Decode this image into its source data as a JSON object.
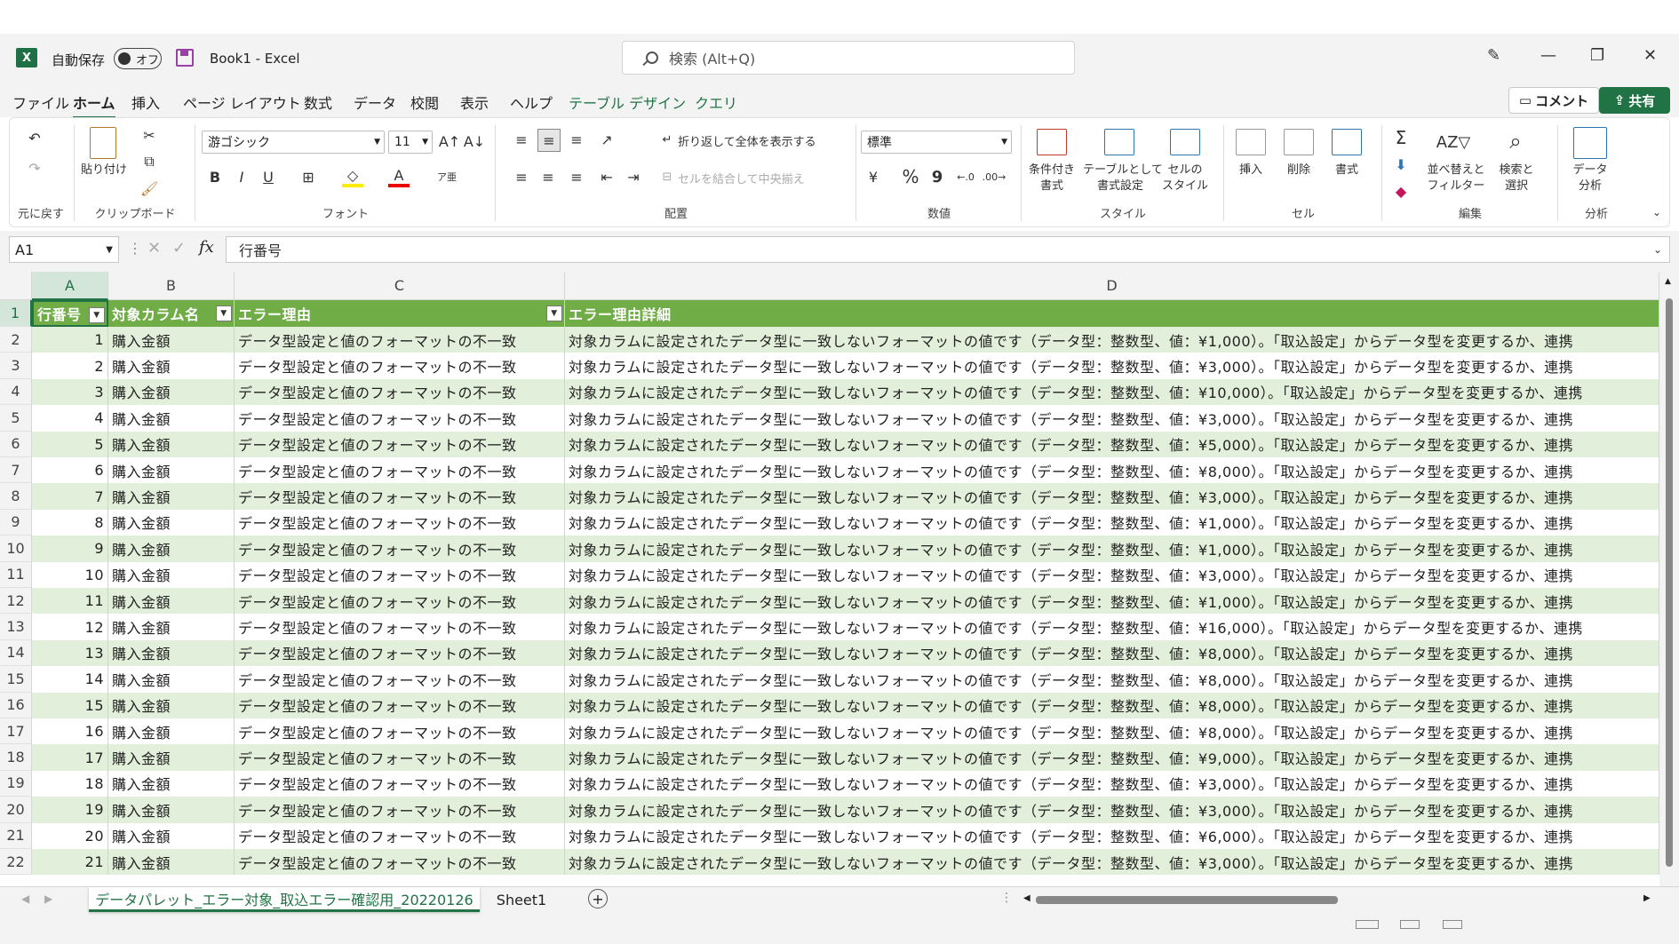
{
  "title_bar": {
    "autosave_label": "自動保存",
    "toggle_label": "オフ",
    "document_title": "Book1  -  Excel",
    "search_placeholder": "検索 (Alt+Q)"
  },
  "ribbon_tabs": [
    "ファイル",
    "ホーム",
    "挿入",
    "ページ レイアウト",
    "数式",
    "データ",
    "校閲",
    "表示",
    "ヘルプ",
    "テーブル デザイン",
    "クエリ"
  ],
  "active_tab": "ホーム",
  "actions": {
    "comment": "コメント",
    "share": "共有"
  },
  "ribbon": {
    "undo_group": "元に戻す",
    "clipboard": {
      "paste": "貼り付け",
      "group": "クリップボード"
    },
    "font": {
      "name": "游ゴシック",
      "size": "11",
      "bold": "B",
      "italic": "I",
      "underline": "U",
      "group": "フォント"
    },
    "alignment": {
      "wrap": "折り返して全体を表示する",
      "merge": "セルを結合して中央揃え",
      "group": "配置"
    },
    "number": {
      "format": "標準",
      "percent": "%",
      "comma": "9",
      "group": "数値"
    },
    "styles": {
      "conditional": "条件付き\n書式",
      "table": "テーブルとして\n書式設定",
      "cell": "セルの\nスタイル",
      "group": "スタイル"
    },
    "cells": {
      "insert": "挿入",
      "delete": "削除",
      "format": "書式",
      "group": "セル"
    },
    "editing": {
      "sort": "並べ替えと\nフィルター",
      "find": "検索と\n選択",
      "group": "編集"
    },
    "analysis": {
      "analyze": "データ\n分析",
      "group": "分析"
    }
  },
  "formula_bar": {
    "name_box": "A1",
    "fx": "fx",
    "content": "行番号"
  },
  "columns": [
    "A",
    "B",
    "C",
    "D"
  ],
  "table_headers": [
    "行番号",
    "対象カラム名",
    "エラー理由",
    "エラー理由詳細"
  ],
  "rows": [
    {
      "n": "1",
      "col": "購入金額",
      "reason": "データ型設定と値のフォーマットの不一致",
      "detail": "対象カラムに設定されたデータ型に一致しないフォーマットの値です（データ型：整数型、値：¥1,000）。「取込設定」からデータ型を変更するか、連携"
    },
    {
      "n": "2",
      "col": "購入金額",
      "reason": "データ型設定と値のフォーマットの不一致",
      "detail": "対象カラムに設定されたデータ型に一致しないフォーマットの値です（データ型：整数型、値：¥3,000）。「取込設定」からデータ型を変更するか、連携"
    },
    {
      "n": "3",
      "col": "購入金額",
      "reason": "データ型設定と値のフォーマットの不一致",
      "detail": "対象カラムに設定されたデータ型に一致しないフォーマットの値です（データ型：整数型、値：¥10,000）。「取込設定」からデータ型を変更するか、連携"
    },
    {
      "n": "4",
      "col": "購入金額",
      "reason": "データ型設定と値のフォーマットの不一致",
      "detail": "対象カラムに設定されたデータ型に一致しないフォーマットの値です（データ型：整数型、値：¥3,000）。「取込設定」からデータ型を変更するか、連携"
    },
    {
      "n": "5",
      "col": "購入金額",
      "reason": "データ型設定と値のフォーマットの不一致",
      "detail": "対象カラムに設定されたデータ型に一致しないフォーマットの値です（データ型：整数型、値：¥5,000）。「取込設定」からデータ型を変更するか、連携"
    },
    {
      "n": "6",
      "col": "購入金額",
      "reason": "データ型設定と値のフォーマットの不一致",
      "detail": "対象カラムに設定されたデータ型に一致しないフォーマットの値です（データ型：整数型、値：¥8,000）。「取込設定」からデータ型を変更するか、連携"
    },
    {
      "n": "7",
      "col": "購入金額",
      "reason": "データ型設定と値のフォーマットの不一致",
      "detail": "対象カラムに設定されたデータ型に一致しないフォーマットの値です（データ型：整数型、値：¥3,000）。「取込設定」からデータ型を変更するか、連携"
    },
    {
      "n": "8",
      "col": "購入金額",
      "reason": "データ型設定と値のフォーマットの不一致",
      "detail": "対象カラムに設定されたデータ型に一致しないフォーマットの値です（データ型：整数型、値：¥1,000）。「取込設定」からデータ型を変更するか、連携"
    },
    {
      "n": "9",
      "col": "購入金額",
      "reason": "データ型設定と値のフォーマットの不一致",
      "detail": "対象カラムに設定されたデータ型に一致しないフォーマットの値です（データ型：整数型、値：¥1,000）。「取込設定」からデータ型を変更するか、連携"
    },
    {
      "n": "10",
      "col": "購入金額",
      "reason": "データ型設定と値のフォーマットの不一致",
      "detail": "対象カラムに設定されたデータ型に一致しないフォーマットの値です（データ型：整数型、値：¥3,000）。「取込設定」からデータ型を変更するか、連携"
    },
    {
      "n": "11",
      "col": "購入金額",
      "reason": "データ型設定と値のフォーマットの不一致",
      "detail": "対象カラムに設定されたデータ型に一致しないフォーマットの値です（データ型：整数型、値：¥1,000）。「取込設定」からデータ型を変更するか、連携"
    },
    {
      "n": "12",
      "col": "購入金額",
      "reason": "データ型設定と値のフォーマットの不一致",
      "detail": "対象カラムに設定されたデータ型に一致しないフォーマットの値です（データ型：整数型、値：¥16,000）。「取込設定」からデータ型を変更するか、連携"
    },
    {
      "n": "13",
      "col": "購入金額",
      "reason": "データ型設定と値のフォーマットの不一致",
      "detail": "対象カラムに設定されたデータ型に一致しないフォーマットの値です（データ型：整数型、値：¥8,000）。「取込設定」からデータ型を変更するか、連携"
    },
    {
      "n": "14",
      "col": "購入金額",
      "reason": "データ型設定と値のフォーマットの不一致",
      "detail": "対象カラムに設定されたデータ型に一致しないフォーマットの値です（データ型：整数型、値：¥8,000）。「取込設定」からデータ型を変更するか、連携"
    },
    {
      "n": "15",
      "col": "購入金額",
      "reason": "データ型設定と値のフォーマットの不一致",
      "detail": "対象カラムに設定されたデータ型に一致しないフォーマットの値です（データ型：整数型、値：¥8,000）。「取込設定」からデータ型を変更するか、連携"
    },
    {
      "n": "16",
      "col": "購入金額",
      "reason": "データ型設定と値のフォーマットの不一致",
      "detail": "対象カラムに設定されたデータ型に一致しないフォーマットの値です（データ型：整数型、値：¥8,000）。「取込設定」からデータ型を変更するか、連携"
    },
    {
      "n": "17",
      "col": "購入金額",
      "reason": "データ型設定と値のフォーマットの不一致",
      "detail": "対象カラムに設定されたデータ型に一致しないフォーマットの値です（データ型：整数型、値：¥9,000）。「取込設定」からデータ型を変更するか、連携"
    },
    {
      "n": "18",
      "col": "購入金額",
      "reason": "データ型設定と値のフォーマットの不一致",
      "detail": "対象カラムに設定されたデータ型に一致しないフォーマットの値です（データ型：整数型、値：¥3,000）。「取込設定」からデータ型を変更するか、連携"
    },
    {
      "n": "19",
      "col": "購入金額",
      "reason": "データ型設定と値のフォーマットの不一致",
      "detail": "対象カラムに設定されたデータ型に一致しないフォーマットの値です（データ型：整数型、値：¥3,000）。「取込設定」からデータ型を変更するか、連携"
    },
    {
      "n": "20",
      "col": "購入金額",
      "reason": "データ型設定と値のフォーマットの不一致",
      "detail": "対象カラムに設定されたデータ型に一致しないフォーマットの値です（データ型：整数型、値：¥6,000）。「取込設定」からデータ型を変更するか、連携"
    },
    {
      "n": "21",
      "col": "購入金額",
      "reason": "データ型設定と値のフォーマットの不一致",
      "detail": "対象カラムに設定されたデータ型に一致しないフォーマットの値です（データ型：整数型、値：¥3,000）。「取込設定」からデータ型を変更するか、連携"
    }
  ],
  "sheet_tabs": [
    "データパレット_エラー対象_取込エラー確認用_20220126",
    "Sheet1"
  ],
  "active_sheet": "データパレット_エラー対象_取込エラー確認用_20220126",
  "colors": {
    "accent": "#217346",
    "table_header": "#70ad47",
    "band": "#e2efda"
  }
}
